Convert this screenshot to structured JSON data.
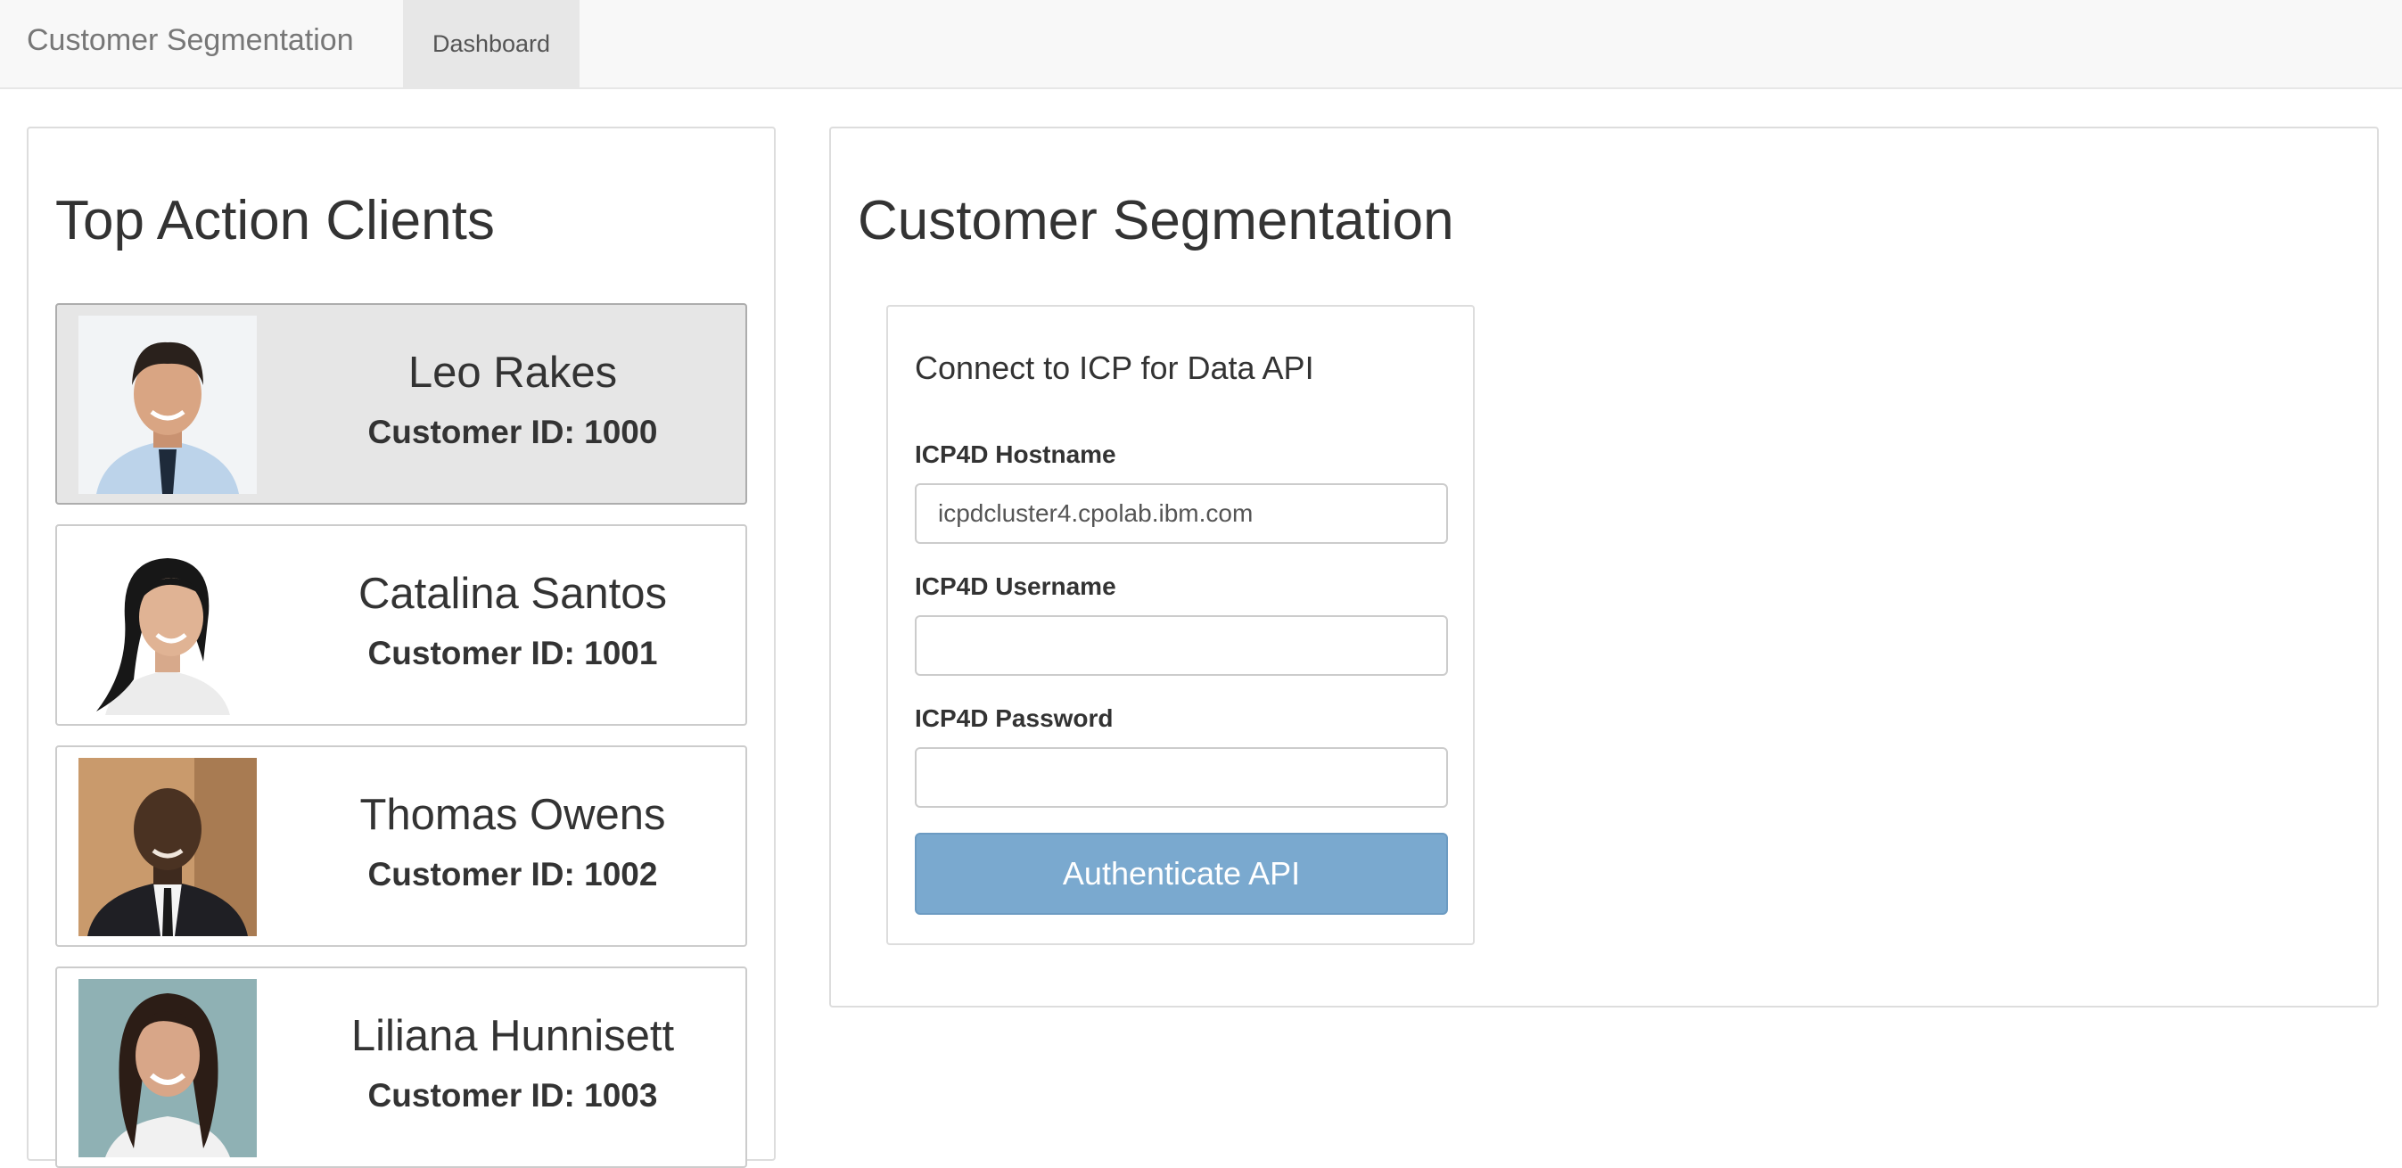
{
  "navbar": {
    "brand": "Customer Segmentation",
    "tabs": [
      {
        "label": "Dashboard"
      }
    ]
  },
  "clients_panel": {
    "title": "Top Action Clients",
    "clients": [
      {
        "name": "Leo Rakes",
        "customer_id": "Customer ID: 1000",
        "active": true
      },
      {
        "name": "Catalina Santos",
        "customer_id": "Customer ID: 1001",
        "active": false
      },
      {
        "name": "Thomas Owens",
        "customer_id": "Customer ID: 1002",
        "active": false
      },
      {
        "name": "Liliana Hunnisett",
        "customer_id": "Customer ID: 1003",
        "active": false
      }
    ]
  },
  "segmentation_panel": {
    "title": "Customer Segmentation",
    "auth": {
      "title": "Connect to ICP for Data API",
      "hostname_label": "ICP4D Hostname",
      "hostname_value": "icpdcluster4.cpolab.ibm.com",
      "username_label": "ICP4D Username",
      "username_value": "",
      "password_label": "ICP4D Password",
      "password_value": "",
      "button_label": "Authenticate API"
    }
  },
  "colors": {
    "navbar_bg": "#f8f8f8",
    "active_tab_bg": "#e7e7e7",
    "active_card_bg": "#e6e6e6",
    "button_bg": "#7aa9cf"
  }
}
